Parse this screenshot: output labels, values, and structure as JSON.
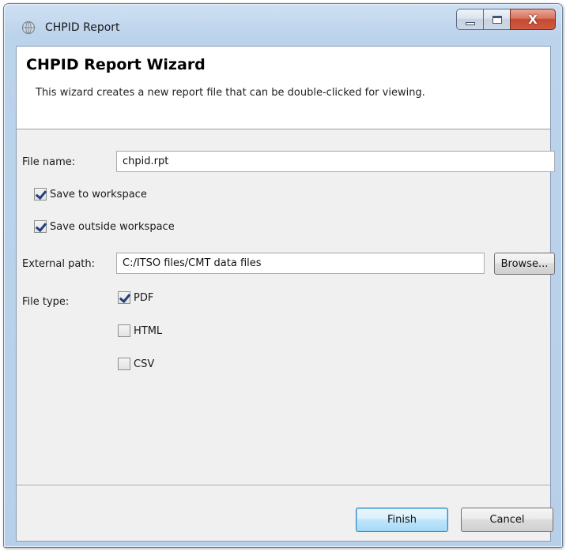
{
  "window": {
    "title": "CHPID Report",
    "icon": "globe-icon",
    "close_glyph": "X"
  },
  "banner": {
    "title": "CHPID Report Wizard",
    "description": "This wizard creates a new report file that can be double-clicked for viewing."
  },
  "form": {
    "file_name_label": "File name:",
    "file_name_value": "chpid.rpt",
    "save_to_workspace_label": "Save to workspace",
    "save_to_workspace_checked": true,
    "save_outside_label": "Save outside workspace",
    "save_outside_checked": true,
    "external_path_label": "External path:",
    "external_path_value": "C:/ITSO files/CMT data files",
    "browse_label": "Browse...",
    "file_type_label": "File type:",
    "file_types": [
      {
        "label": "PDF",
        "checked": true
      },
      {
        "label": "HTML",
        "checked": false
      },
      {
        "label": "CSV",
        "checked": false
      }
    ]
  },
  "buttons": {
    "finish_label": "Finish",
    "cancel_label": "Cancel"
  },
  "colors": {
    "titlebar": "#bcd3ec",
    "close_button": "#c34a32",
    "default_button": "#bee6fd",
    "checkmark": "#243f7a"
  }
}
